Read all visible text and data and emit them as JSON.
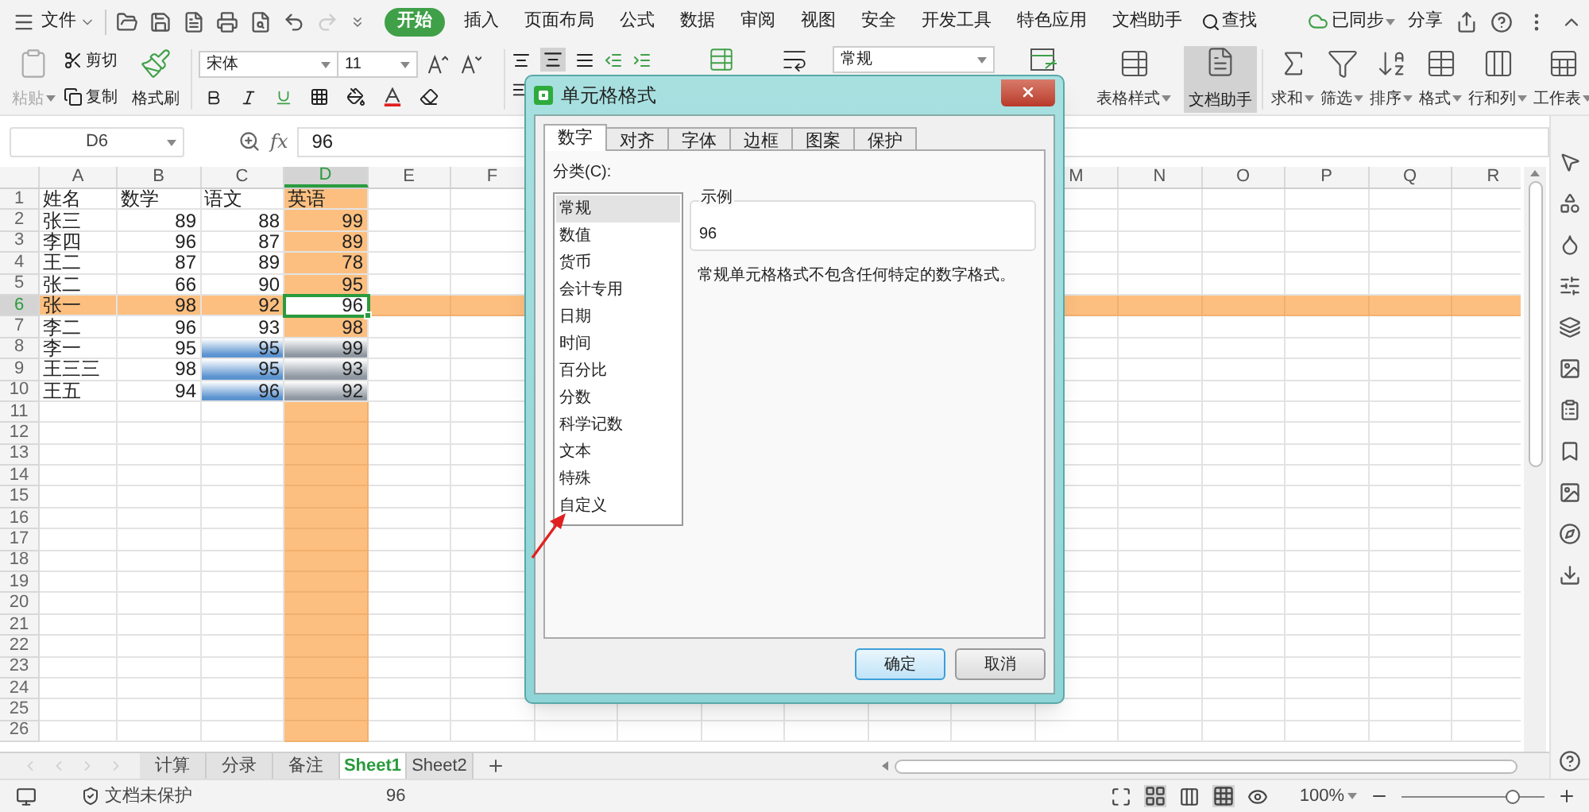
{
  "menu": {
    "file": "文件",
    "tabs": [
      {
        "label": "开始",
        "selected": true
      },
      {
        "label": "插入",
        "selected": false
      },
      {
        "label": "页面布局",
        "selected": false
      },
      {
        "label": "公式",
        "selected": false
      },
      {
        "label": "数据",
        "selected": false
      },
      {
        "label": "审阅",
        "selected": false
      },
      {
        "label": "视图",
        "selected": false
      },
      {
        "label": "安全",
        "selected": false
      },
      {
        "label": "开发工具",
        "selected": false
      },
      {
        "label": "特色应用",
        "selected": false
      },
      {
        "label": "文档助手",
        "selected": false
      }
    ],
    "search": "查找",
    "sync": "已同步",
    "share": "分享"
  },
  "ribbon": {
    "paste": {
      "label": "粘贴",
      "disabled": true
    },
    "cut": "剪切",
    "copy": "复制",
    "format_painter": "格式刷",
    "font": "宋体",
    "font_size": "11",
    "number_format": "常规",
    "table_style": "表格样式",
    "assistant": {
      "label": "文档助手",
      "pressed": true
    },
    "tools": [
      "求和",
      "筛选",
      "排序",
      "格式",
      "行和列",
      "工作表"
    ]
  },
  "formula_bar": {
    "name_box": "D6",
    "fx": "fx",
    "value": "96"
  },
  "sheet": {
    "columns": [
      {
        "label": "A",
        "selected": false
      },
      {
        "label": "B",
        "selected": false
      },
      {
        "label": "C",
        "selected": false
      },
      {
        "label": "D",
        "selected": true
      },
      {
        "label": "E",
        "selected": false
      },
      {
        "label": "F",
        "selected": false
      },
      {
        "label": "M",
        "selected": false
      },
      {
        "label": "N",
        "selected": false
      },
      {
        "label": "O",
        "selected": false
      },
      {
        "label": "P",
        "selected": false
      },
      {
        "label": "Q",
        "selected": false
      },
      {
        "label": "R",
        "selected": false
      }
    ],
    "rows": [
      {
        "number": "1",
        "selected": false,
        "cells": [
          {
            "text": "姓名",
            "kind": "text",
            "active": false
          },
          {
            "text": "数学",
            "kind": "text",
            "active": false
          },
          {
            "text": "语文",
            "kind": "text",
            "active": false
          },
          {
            "text": "英语",
            "kind": "text",
            "active": false
          }
        ]
      },
      {
        "number": "2",
        "selected": false,
        "cells": [
          {
            "text": "张三",
            "kind": "text",
            "active": false
          },
          {
            "text": "89",
            "kind": "number",
            "active": false
          },
          {
            "text": "88",
            "kind": "number",
            "active": false
          },
          {
            "text": "99",
            "kind": "number",
            "active": false
          }
        ]
      },
      {
        "number": "3",
        "selected": false,
        "cells": [
          {
            "text": "李四",
            "kind": "text",
            "active": false
          },
          {
            "text": "96",
            "kind": "number",
            "active": false
          },
          {
            "text": "87",
            "kind": "number",
            "active": false
          },
          {
            "text": "89",
            "kind": "number",
            "active": false
          }
        ]
      },
      {
        "number": "4",
        "selected": false,
        "cells": [
          {
            "text": "王二",
            "kind": "text",
            "active": false
          },
          {
            "text": "87",
            "kind": "number",
            "active": false
          },
          {
            "text": "89",
            "kind": "number",
            "active": false
          },
          {
            "text": "78",
            "kind": "number",
            "active": false
          }
        ]
      },
      {
        "number": "5",
        "selected": false,
        "cells": [
          {
            "text": "张二",
            "kind": "text",
            "active": false
          },
          {
            "text": "66",
            "kind": "number",
            "active": false
          },
          {
            "text": "90",
            "kind": "number",
            "active": false
          },
          {
            "text": "95",
            "kind": "number",
            "active": false
          }
        ]
      },
      {
        "number": "6",
        "selected": true,
        "cells": [
          {
            "text": "张一",
            "kind": "text",
            "active": false
          },
          {
            "text": "98",
            "kind": "number",
            "active": false
          },
          {
            "text": "92",
            "kind": "number",
            "active": false
          },
          {
            "text": "96",
            "kind": "number",
            "active": true
          }
        ]
      },
      {
        "number": "7",
        "selected": false,
        "cells": [
          {
            "text": "李二",
            "kind": "text",
            "active": false
          },
          {
            "text": "96",
            "kind": "number",
            "active": false
          },
          {
            "text": "93",
            "kind": "number",
            "active": false
          },
          {
            "text": "98",
            "kind": "number",
            "active": false
          }
        ]
      },
      {
        "number": "8",
        "selected": false,
        "cells": [
          {
            "text": "李一",
            "kind": "text",
            "active": false
          },
          {
            "text": "95",
            "kind": "number",
            "active": false
          },
          {
            "text": "95",
            "kind": "number",
            "color": "#5b93d0",
            "active": false
          },
          {
            "text": "99",
            "kind": "number",
            "color": "#8f98a2",
            "active": false
          }
        ]
      },
      {
        "number": "9",
        "selected": false,
        "cells": [
          {
            "text": "王三三",
            "kind": "text",
            "active": false
          },
          {
            "text": "98",
            "kind": "number",
            "active": false
          },
          {
            "text": "95",
            "kind": "number",
            "color": "#5b93d0",
            "active": false
          },
          {
            "text": "93",
            "kind": "number",
            "color": "#8f98a2",
            "active": false
          }
        ]
      },
      {
        "number": "10",
        "selected": false,
        "cells": [
          {
            "text": "王五",
            "kind": "text",
            "active": false
          },
          {
            "text": "94",
            "kind": "number",
            "active": false
          },
          {
            "text": "96",
            "kind": "number",
            "color": "#5b93d0",
            "active": false
          },
          {
            "text": "92",
            "kind": "number",
            "color": "#8f98a2",
            "active": false
          }
        ]
      },
      {
        "number": "11",
        "selected": false
      },
      {
        "number": "12",
        "selected": false
      },
      {
        "number": "13",
        "selected": false
      },
      {
        "number": "14",
        "selected": false
      },
      {
        "number": "15",
        "selected": false
      },
      {
        "number": "16",
        "selected": false
      },
      {
        "number": "17",
        "selected": false
      },
      {
        "number": "18",
        "selected": false
      },
      {
        "number": "19",
        "selected": false
      },
      {
        "number": "20",
        "selected": false
      },
      {
        "number": "21",
        "selected": false
      },
      {
        "number": "22",
        "selected": false
      },
      {
        "number": "23",
        "selected": false
      },
      {
        "number": "24",
        "selected": false
      },
      {
        "number": "25",
        "selected": false
      },
      {
        "number": "26",
        "selected": false
      }
    ]
  },
  "sheet_tabs": [
    {
      "label": "计算",
      "selected": false
    },
    {
      "label": "分录",
      "selected": false
    },
    {
      "label": "备注",
      "selected": false
    },
    {
      "label": "Sheet1",
      "selected": true
    },
    {
      "label": "Sheet2",
      "selected": false
    }
  ],
  "status_bar": {
    "protection": "文档未保护",
    "value": "96",
    "zoom": "100%",
    "zoom_slider": {
      "level": 0.78
    }
  },
  "dialog": {
    "title": "单元格格式",
    "tabs": [
      {
        "label": "数字",
        "selected": true
      },
      {
        "label": "对齐",
        "selected": false
      },
      {
        "label": "字体",
        "selected": false
      },
      {
        "label": "边框",
        "selected": false
      },
      {
        "label": "图案",
        "selected": false
      },
      {
        "label": "保护",
        "selected": false
      }
    ],
    "category_label": "分类(C):",
    "categories": [
      {
        "label": "常规",
        "selected": true
      },
      {
        "label": "数值",
        "selected": false
      },
      {
        "label": "货币",
        "selected": false
      },
      {
        "label": "会计专用",
        "selected": false
      },
      {
        "label": "日期",
        "selected": false
      },
      {
        "label": "时间",
        "selected": false
      },
      {
        "label": "百分比",
        "selected": false
      },
      {
        "label": "分数",
        "selected": false
      },
      {
        "label": "科学记数",
        "selected": false
      },
      {
        "label": "文本",
        "selected": false
      },
      {
        "label": "特殊",
        "selected": false
      },
      {
        "label": "自定义",
        "selected": false
      }
    ],
    "sample_label": "示例",
    "sample": "96",
    "description": "常规单元格格式不包含任何特定的数字格式。",
    "buttons": [
      {
        "label": "确定",
        "default": true
      },
      {
        "label": "取消",
        "default": false
      }
    ]
  }
}
